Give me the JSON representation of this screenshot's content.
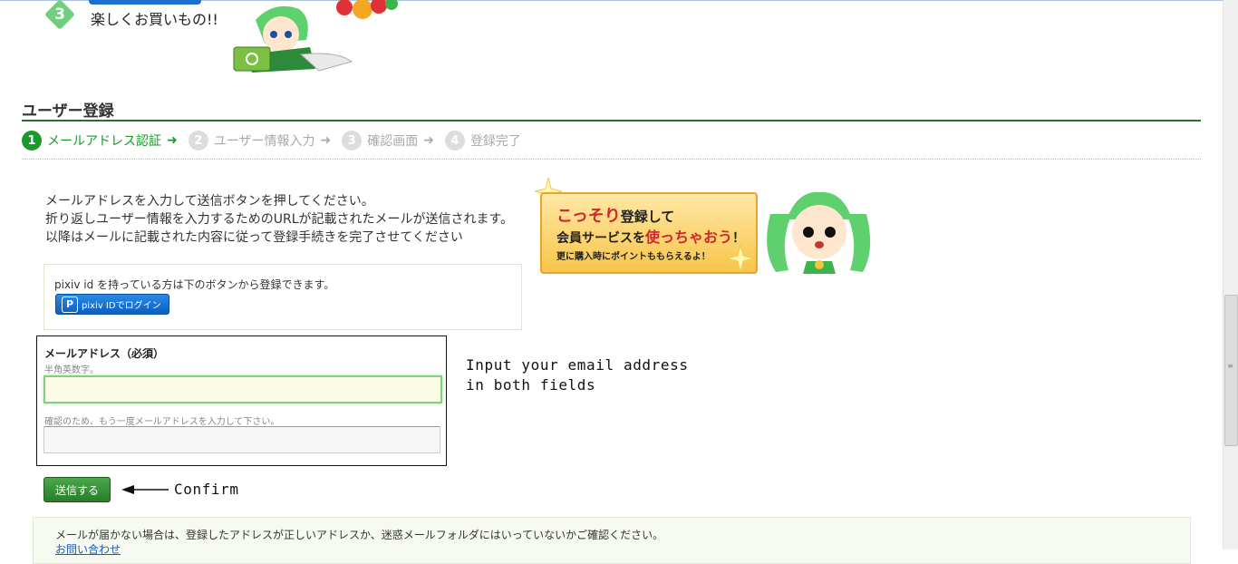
{
  "step3": {
    "number": "3",
    "text": "楽しくお買いもの!!"
  },
  "section": {
    "title": "ユーザー登録"
  },
  "steps": [
    {
      "num": "1",
      "label": "メールアドレス認証",
      "active": true
    },
    {
      "num": "2",
      "label": "ユーザー情報入力",
      "active": false
    },
    {
      "num": "3",
      "label": "確認画面",
      "active": false
    },
    {
      "num": "4",
      "label": "登録完了",
      "active": false
    }
  ],
  "intro": {
    "line1": "メールアドレスを入力して送信ボタンを押してください。",
    "line2": "折り返しユーザー情報を入力するためのURLが記載されたメールが送信されます。",
    "line3": "以降はメールに記載された内容に従って登録手続きを完了させてください"
  },
  "pixiv": {
    "text": "pixiv id を持っている方は下のボタンから登録できます。",
    "button_icon": "P",
    "button_label": "pixiv IDでログイン"
  },
  "banner": {
    "line1_red": "こっそり",
    "line1_rest": "登録して",
    "line2_a": "会員サービスを",
    "line2_red": "使っちゃおう",
    "line2_end": "！",
    "line3": "更に購入時にポイントももらえるよ！"
  },
  "form": {
    "email_label": "メールアドレス（必須）",
    "email_hint": "半角英数字。",
    "email_value": "",
    "confirm_hint": "確認のため、もう一度メールアドレスを入力して下さい。",
    "confirm_value": ""
  },
  "annotations": {
    "email_line1": "Input your email address",
    "email_line2": "in both fields",
    "confirm": "Confirm"
  },
  "submit": {
    "label": "送信する"
  },
  "notice": {
    "text": "メールが届かない場合は、登録したアドレスが正しいアドレスか、迷惑メールフォルダにはいっていないかご確認ください。",
    "link": "お問い合わせ"
  },
  "colors": {
    "accent_green": "#1a9a2a",
    "rule_green": "#2e6b2e",
    "pixiv_blue": "#0b5fbf"
  }
}
